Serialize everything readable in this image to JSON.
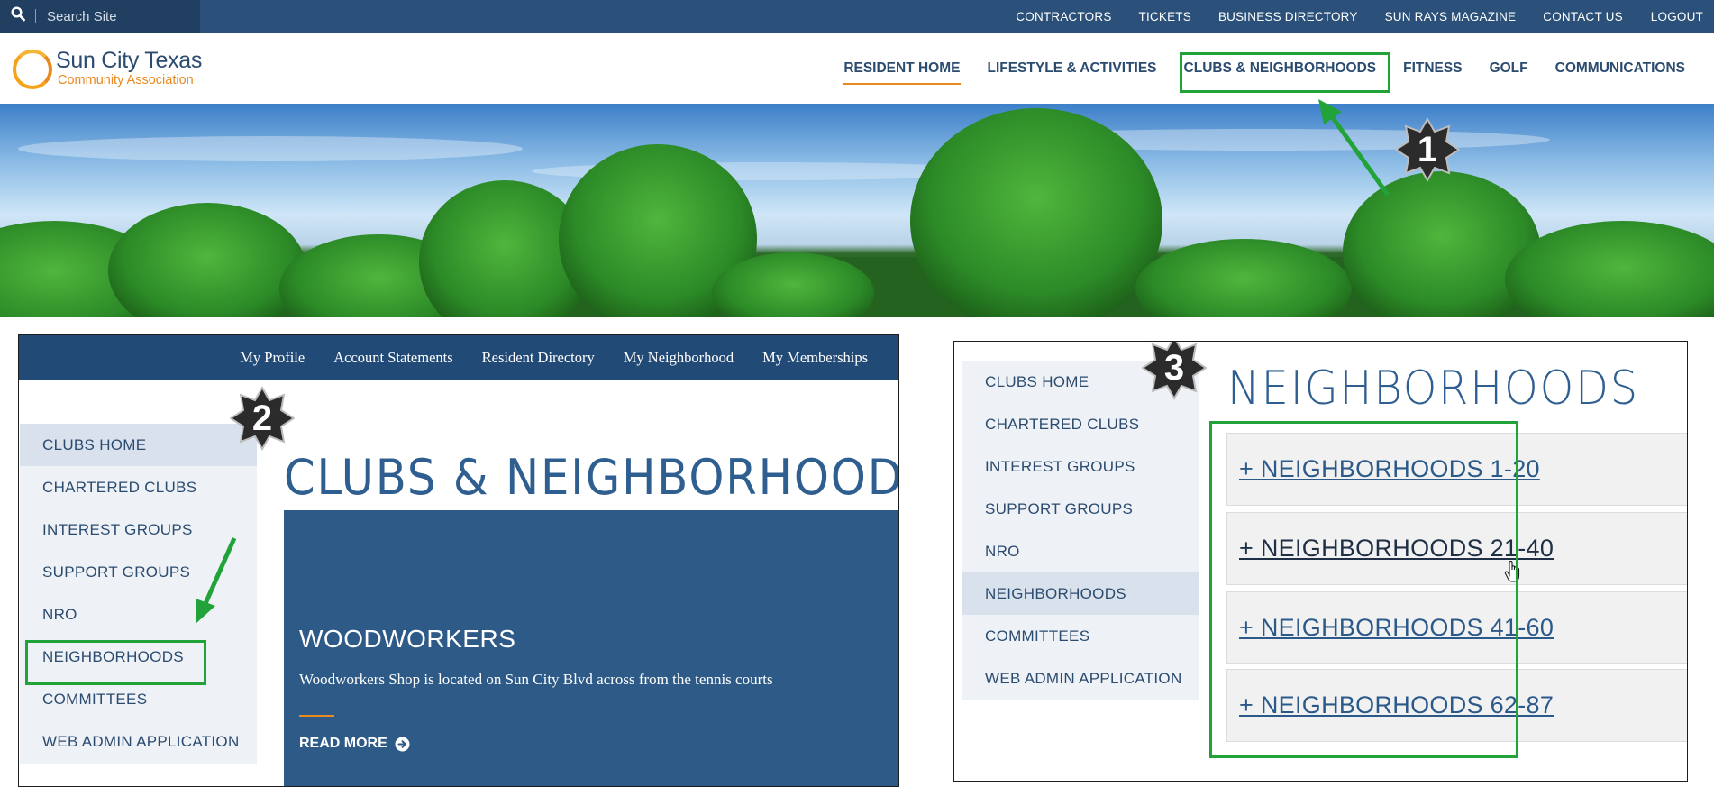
{
  "search": {
    "placeholder": "Search Site"
  },
  "utility_nav": [
    "CONTRACTORS",
    "TICKETS",
    "BUSINESS DIRECTORY",
    "SUN RAYS MAGAZINE",
    "CONTACT US",
    "LOGOUT"
  ],
  "logo": {
    "name": "Sun City Texas",
    "subtitle": "Community Association"
  },
  "main_nav": [
    "RESIDENT HOME",
    "LIFESTYLE & ACTIVITIES",
    "CLUBS & NEIGHBORHOODS",
    "FITNESS",
    "GOLF",
    "COMMUNICATIONS"
  ],
  "main_nav_active": "RESIDENT HOME",
  "annotations": {
    "step1": "1",
    "step2": "2",
    "step3": "3",
    "highlight_color": "#22a33a"
  },
  "member_nav": [
    "My Profile",
    "Account Statements",
    "Resident Directory",
    "My Neighborhood",
    "My Memberships"
  ],
  "side_menu": [
    "CLUBS HOME",
    "CHARTERED CLUBS",
    "INTEREST GROUPS",
    "SUPPORT GROUPS",
    "NRO",
    "NEIGHBORHOODS",
    "COMMITTEES",
    "WEB ADMIN APPLICATION"
  ],
  "panel2": {
    "active_item": "CLUBS HOME",
    "title": "CLUBS & NEIGHBORHOODS",
    "card": {
      "title": "WOODWORKERS",
      "text": "Woodworkers Shop is located on Sun City Blvd across from the tennis courts",
      "read_more": "READ MORE"
    }
  },
  "panel3": {
    "active_item": "NEIGHBORHOODS",
    "title": "NEIGHBORHOODS",
    "accordion": [
      "+ NEIGHBORHOODS 1-20",
      "+ NEIGHBORHOODS 21-40",
      "+ NEIGHBORHOODS 41-60",
      "+ NEIGHBORHOODS 62-87"
    ]
  },
  "colors": {
    "navy": "#224a76",
    "accent_orange": "#e98a1f",
    "side_bg": "#eef2f7",
    "card_bg": "#2d5a86"
  }
}
